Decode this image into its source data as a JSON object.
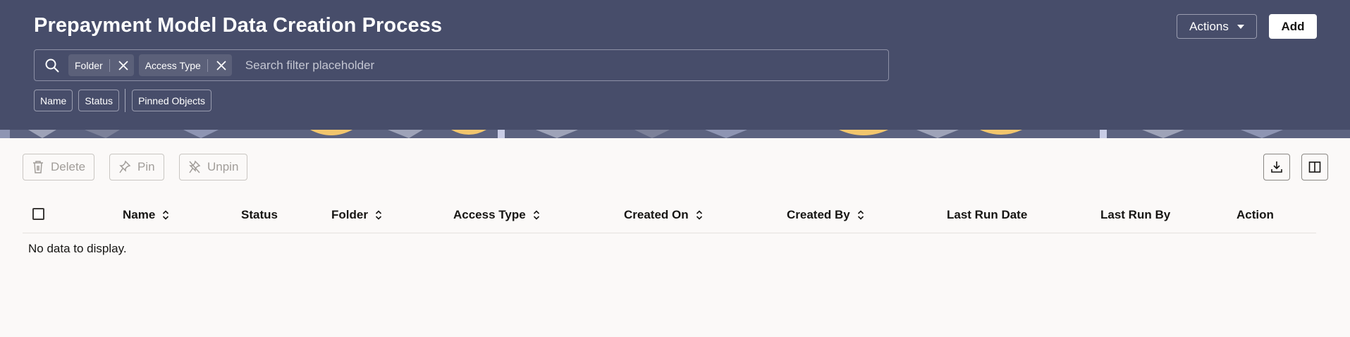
{
  "header": {
    "title": "Prepayment Model Data Creation Process",
    "actions_label": "Actions",
    "add_label": "Add"
  },
  "search": {
    "chips": [
      {
        "label": "Folder"
      },
      {
        "label": "Access Type"
      }
    ],
    "placeholder": "Search filter placeholder"
  },
  "filters": [
    {
      "label": "Name"
    },
    {
      "label": "Status"
    },
    {
      "label": "Pinned Objects"
    }
  ],
  "toolbar": {
    "delete_label": "Delete",
    "pin_label": "Pin",
    "unpin_label": "Unpin"
  },
  "table": {
    "columns": [
      {
        "label": "Name",
        "sortable": true
      },
      {
        "label": "Status",
        "sortable": false
      },
      {
        "label": "Folder",
        "sortable": true
      },
      {
        "label": "Access Type",
        "sortable": true
      },
      {
        "label": "Created On",
        "sortable": true
      },
      {
        "label": "Created By",
        "sortable": true
      },
      {
        "label": "Last Run Date",
        "sortable": false
      },
      {
        "label": "Last Run By",
        "sortable": false
      },
      {
        "label": "Action",
        "sortable": false
      }
    ],
    "empty_message": "No data to display."
  },
  "colors": {
    "header_bg": "#474d6a",
    "page_bg": "#fbf9f8",
    "chip_bg": "#5b6079",
    "band_accent": "#f2c66d"
  },
  "icons": [
    "search-icon",
    "close-icon",
    "trash-icon",
    "pin-icon",
    "unpin-icon",
    "download-icon",
    "columns-icon",
    "sort-icon",
    "caret-down-icon"
  ]
}
